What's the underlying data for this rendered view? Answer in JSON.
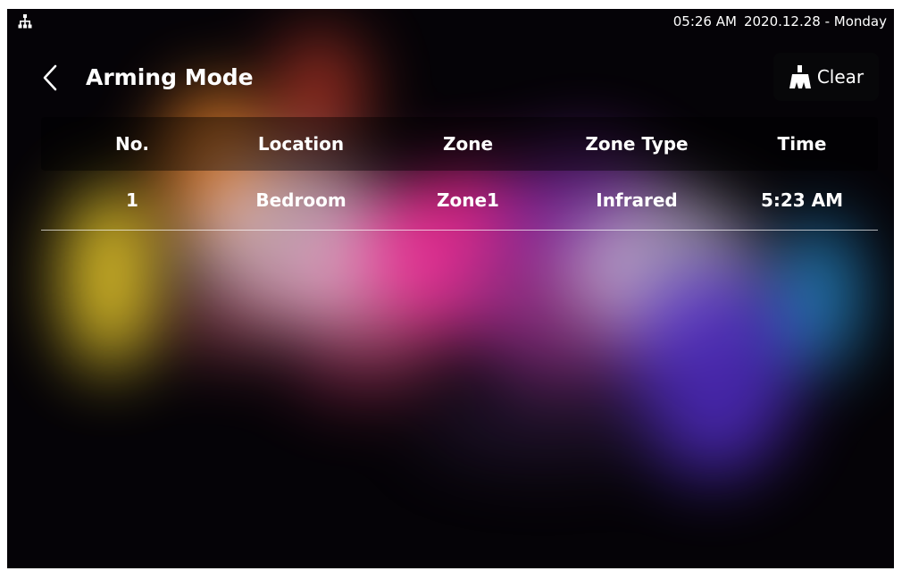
{
  "status_bar": {
    "time": "05:26 AM",
    "date": "2020.12.28 - Monday",
    "network_icon": "network-icon"
  },
  "header": {
    "title": "Arming Mode",
    "back_icon": "chevron-left-icon",
    "clear_label": "Clear",
    "clear_icon": "broom-icon"
  },
  "table": {
    "columns": [
      "No.",
      "Location",
      "Zone",
      "Zone Type",
      "Time"
    ],
    "rows": [
      [
        "1",
        "Bedroom",
        "Zone1",
        "Infrared",
        "5:23 AM"
      ]
    ]
  },
  "colors": {
    "text": "#ffffff",
    "background": "#050307",
    "divider": "#cfcfd6"
  }
}
